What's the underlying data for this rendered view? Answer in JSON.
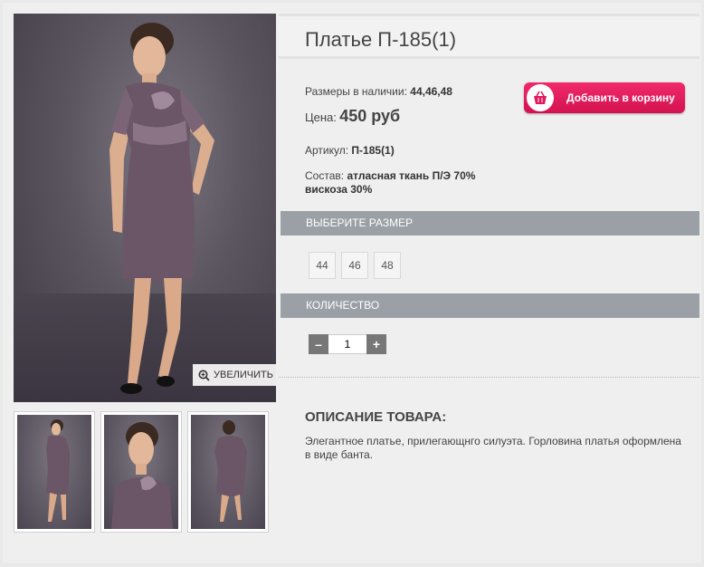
{
  "product": {
    "title": "Платье П-185(1)",
    "sizes_label": "Размеры в наличии:",
    "sizes_value": "44,46,48",
    "price_label": "Цена:",
    "price_value": "450 руб",
    "article_label": "Артикул:",
    "article_value": "П-185(1)",
    "composition_label": "Состав:",
    "composition_value": "атласная ткань П/Э 70% вискоза 30%"
  },
  "gallery": {
    "zoom_label": "УВЕЛИЧИТЬ",
    "zoom_icon": "magnifier-plus-icon",
    "thumbnails": [
      "full-length-front",
      "portrait",
      "full-length-back"
    ]
  },
  "cart": {
    "button_label": "Добавить в корзину",
    "icon": "basket-icon",
    "color": "#e01a5c"
  },
  "size_selector": {
    "heading": "ВЫБЕРИТЕ РАЗМЕР",
    "options": [
      "44",
      "46",
      "48"
    ]
  },
  "quantity": {
    "heading": "КОЛИЧЕСТВО",
    "minus": "–",
    "plus": "+",
    "value": "1"
  },
  "description": {
    "heading": "ОПИСАНИЕ ТОВАРА:",
    "text": "Элегантное платье, прилегающнго силуэта. Горловина платья оформлена в виде банта."
  },
  "colors": {
    "section_bar": "#9aa0a5",
    "accent": "#e01a5c",
    "dress": "#5e4a5a"
  }
}
